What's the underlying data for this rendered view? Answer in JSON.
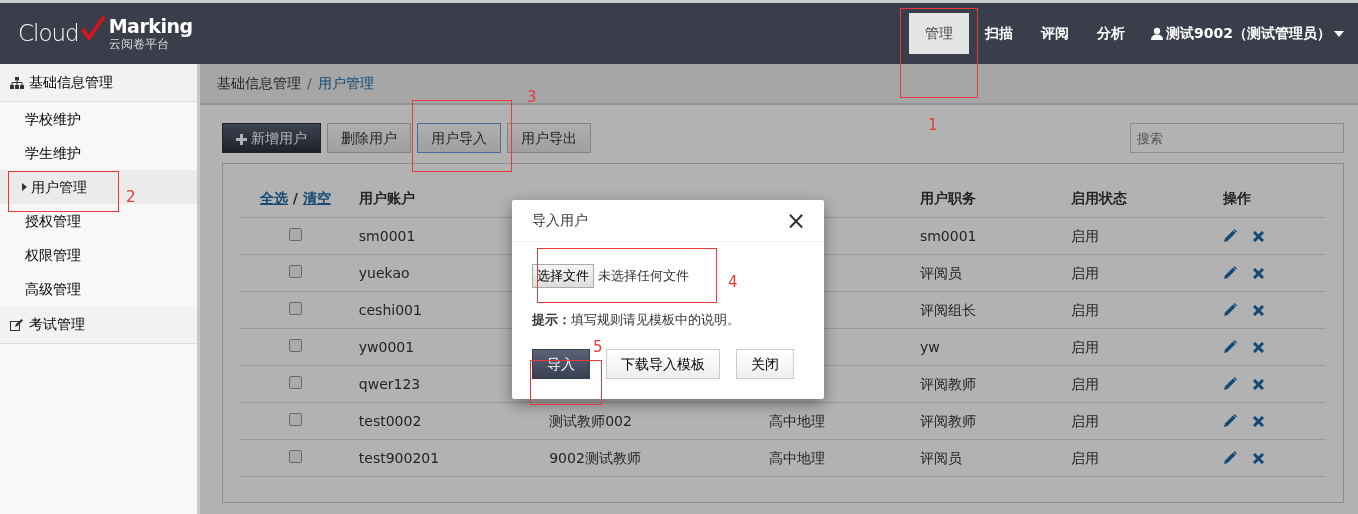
{
  "logo": {
    "word": "Cloud",
    "brand": "Marking",
    "subtitle": "云阅卷平台"
  },
  "nav": [
    {
      "label": "管理",
      "selected": true
    },
    {
      "label": "扫描",
      "selected": false
    },
    {
      "label": "评阅",
      "selected": false
    },
    {
      "label": "分析",
      "selected": false
    }
  ],
  "user_menu": {
    "label": "测试9002（测试管理员）"
  },
  "sidebar": {
    "groups": [
      {
        "label": "基础信息管理",
        "children": [
          {
            "label": "学校维护",
            "selected": false
          },
          {
            "label": "学生维护",
            "selected": false
          },
          {
            "label": "用户管理",
            "selected": true
          },
          {
            "label": "授权管理",
            "selected": false
          },
          {
            "label": "权限管理",
            "selected": false
          },
          {
            "label": "高级管理",
            "selected": false
          }
        ]
      },
      {
        "label": "考试管理"
      }
    ]
  },
  "breadcrumb": {
    "items": [
      "基础信息管理",
      "用户管理"
    ],
    "separator": "/"
  },
  "toolbar": {
    "buttons": [
      {
        "label": "新增用户",
        "kind": "primary"
      },
      {
        "label": "删除用户",
        "kind": "default"
      },
      {
        "label": "用户导入",
        "kind": "focused"
      },
      {
        "label": "用户导出",
        "kind": "default"
      }
    ],
    "search": {
      "placeholder": "搜索"
    }
  },
  "table": {
    "select_all": "全选",
    "separator": "/",
    "clear": "清空",
    "columns": [
      "用户账户",
      "用户职务",
      "启用状态",
      "操作"
    ],
    "rows": [
      {
        "checked": false,
        "account": "sm0001",
        "role": "sm0001",
        "status": "启用"
      },
      {
        "checked": false,
        "account": "yuekao",
        "role": "评阅员",
        "status": "启用"
      },
      {
        "checked": false,
        "account": "ceshi001",
        "role": "评阅组长",
        "status": "启用"
      },
      {
        "checked": false,
        "account": "yw0001",
        "role": "yw",
        "status": "启用"
      },
      {
        "checked": false,
        "account": "qwer123",
        "role": "评阅教师",
        "status": "启用"
      },
      {
        "checked": false,
        "account": "test0002",
        "name": "测试教师002",
        "subject": "高中地理",
        "role": "评阅教师",
        "status": "启用"
      },
      {
        "checked": false,
        "account": "test900201",
        "name": "9002测试教师",
        "subject": "高中地理",
        "role": "评阅员",
        "status": "启用"
      }
    ]
  },
  "modal": {
    "title": "导入用户",
    "close": "×",
    "file_button": "选择文件",
    "file_status": "未选择任何文件",
    "hint_label": "提示：",
    "hint": "填写规则请见模板中的说明。",
    "buttons": [
      {
        "label": "导入",
        "kind": "primary"
      },
      {
        "label": "下载导入模板",
        "kind": "default"
      },
      {
        "label": "关闭",
        "kind": "default"
      }
    ]
  },
  "annotations": [
    {
      "label": "1"
    },
    {
      "label": "2"
    },
    {
      "label": "3"
    },
    {
      "label": "4"
    },
    {
      "label": "5"
    }
  ]
}
